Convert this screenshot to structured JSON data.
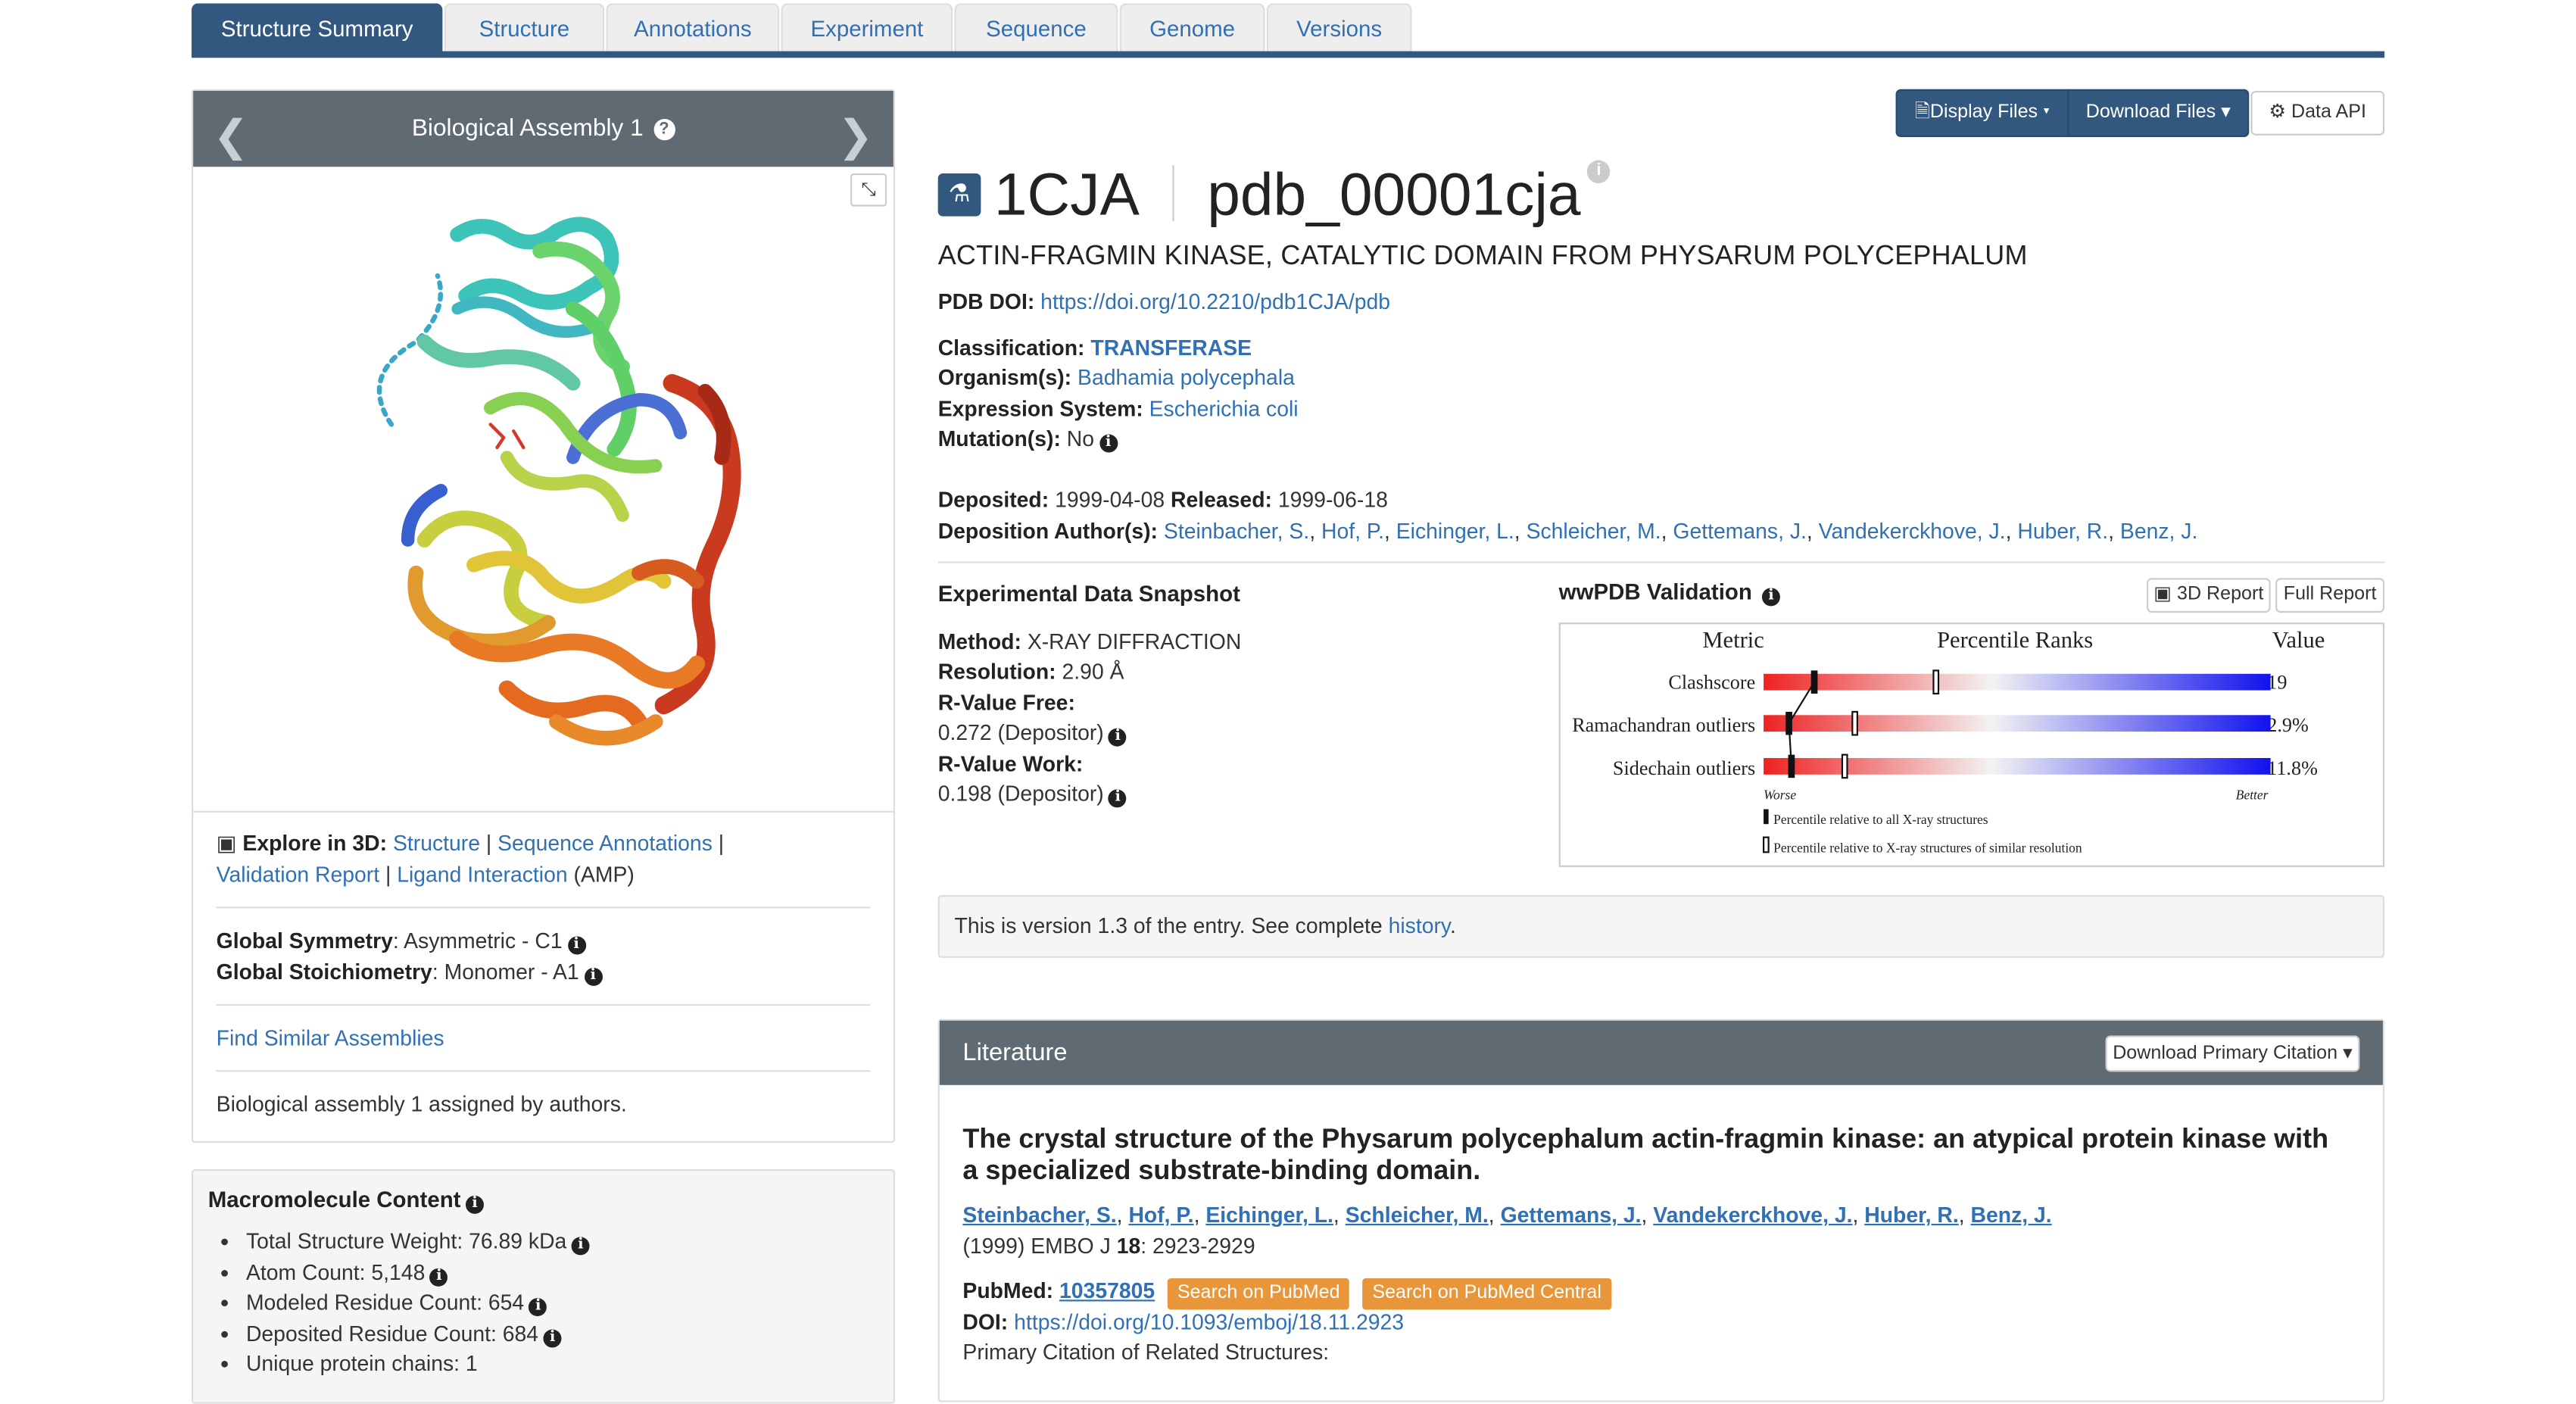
{
  "tabs": [
    {
      "label": "Structure Summary",
      "active": true
    },
    {
      "label": "Structure"
    },
    {
      "label": "Annotations"
    },
    {
      "label": "Experiment"
    },
    {
      "label": "Sequence"
    },
    {
      "label": "Genome"
    },
    {
      "label": "Versions"
    }
  ],
  "assembly": {
    "title": "Biological Assembly 1",
    "help_icon": "question-circle-icon",
    "explore_label": "Explore in 3D",
    "links": [
      "Structure",
      "Sequence Annotations",
      "Validation Report",
      "Ligand Interaction"
    ],
    "ligand_suffix": "(AMP)",
    "global_symmetry_label": "Global Symmetry",
    "global_symmetry_value": "Asymmetric - C1",
    "global_stoich_label": "Global Stoichiometry",
    "global_stoich_value": "Monomer - A1",
    "find_similar": "Find Similar Assemblies",
    "assigned_note": "Biological assembly 1 assigned by authors."
  },
  "macromolecule": {
    "title": "Macromolecule Content",
    "items": [
      "Total Structure Weight: 76.89 kDa",
      "Atom Count: 5,148",
      "Modeled Residue Count: 654",
      "Deposited Residue Count: 684",
      "Unique protein chains: 1"
    ]
  },
  "toolbar": {
    "display_files": "Display Files",
    "download_files": "Download Files",
    "data_api": "Data API"
  },
  "entry": {
    "pdb_id": "1CJA",
    "ext_id": "pdb_00001cja",
    "title": "ACTIN-FRAGMIN KINASE, CATALYTIC DOMAIN FROM PHYSARUM POLYCEPHALUM",
    "doi_label": "PDB DOI:",
    "doi": "https://doi.org/10.2210/pdb1CJA/pdb",
    "classification_label": "Classification:",
    "classification": "TRANSFERASE",
    "organism_label": "Organism(s):",
    "organism": "Badhamia polycephala",
    "expression_label": "Expression System:",
    "expression": "Escherichia coli",
    "mutation_label": "Mutation(s):",
    "mutation": "No",
    "deposited_label": "Deposited:",
    "deposited": "1999-04-08",
    "released_label": "Released:",
    "released": "1999-06-18",
    "authors_label": "Deposition Author(s):",
    "authors": [
      "Steinbacher, S.",
      "Hof, P.",
      "Eichinger, L.",
      "Schleicher, M.",
      "Gettemans, J.",
      "Vandekerckhove, J.",
      "Huber, R.",
      "Benz, J."
    ]
  },
  "snapshot": {
    "title": "Experimental Data Snapshot",
    "method_label": "Method:",
    "method": "X-RAY DIFFRACTION",
    "resolution_label": "Resolution:",
    "resolution": "2.90 Å",
    "rfree_label": "R-Value Free:",
    "rfree": "0.272 (Depositor)",
    "rwork_label": "R-Value Work:",
    "rwork": "0.198 (Depositor)"
  },
  "validation": {
    "title": "wwPDB Validation",
    "report_3d": "3D Report",
    "full_report": "Full Report",
    "col_metric": "Metric",
    "col_percentile": "Percentile Ranks",
    "col_value": "Value",
    "rows": [
      {
        "metric": "Clashscore",
        "value": "19",
        "pct_all": 0.1,
        "pct_res": 0.34
      },
      {
        "metric": "Ramachandran outliers",
        "value": "2.9%",
        "pct_all": 0.05,
        "pct_res": 0.18
      },
      {
        "metric": "Sidechain outliers",
        "value": "11.8%",
        "pct_all": 0.055,
        "pct_res": 0.16
      }
    ],
    "worse": "Worse",
    "better": "Better",
    "legend_all": "Percentile relative to all X-ray structures",
    "legend_res": "Percentile relative to X-ray structures of similar resolution"
  },
  "version_note": {
    "text": "This is version 1.3 of the entry. See complete",
    "link": "history",
    "end": "."
  },
  "literature": {
    "header": "Literature",
    "download_btn": "Download Primary Citation",
    "title": "The crystal structure of the Physarum polycephalum actin-fragmin kinase: an atypical protein kinase with a specialized substrate-binding domain.",
    "authors": [
      "Steinbacher, S.",
      "Hof, P.",
      "Eichinger, L.",
      "Schleicher, M.",
      "Gettemans, J.",
      "Vandekerckhove, J.",
      "Huber, R.",
      "Benz, J."
    ],
    "journal_prefix": "(1999) EMBO J",
    "volume": "18",
    "pages": ": 2923-2929",
    "pubmed_label": "PubMed:",
    "pubmed_id": "10357805",
    "search_pubmed": "Search on PubMed",
    "search_pmc": "Search on PubMed Central",
    "doi_label": "DOI:",
    "doi": "https://doi.org/10.1093/emboj/18.11.2923",
    "related": "Primary Citation of Related Structures:"
  }
}
